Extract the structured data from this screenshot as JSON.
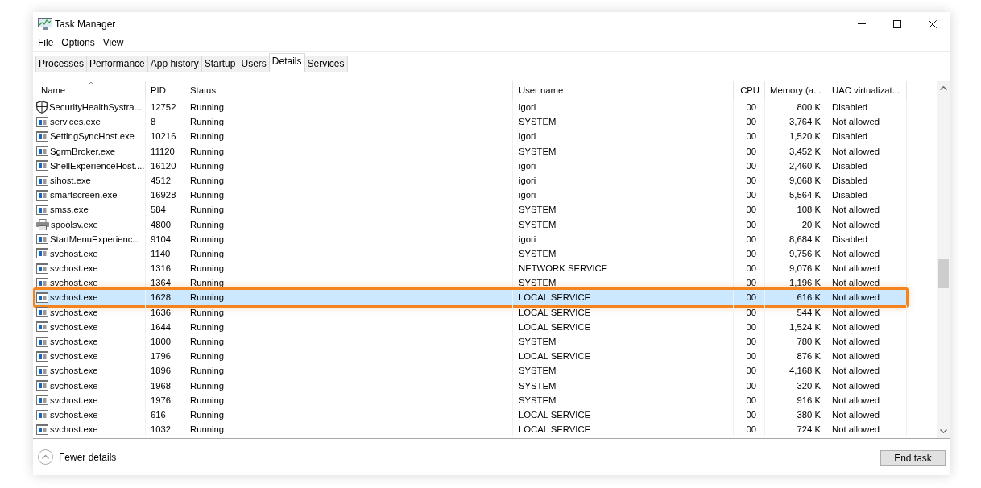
{
  "window": {
    "title": "Task Manager"
  },
  "menu": [
    "File",
    "Options",
    "View"
  ],
  "tabs": [
    {
      "label": "Processes",
      "selected": false
    },
    {
      "label": "Performance",
      "selected": false
    },
    {
      "label": "App history",
      "selected": false
    },
    {
      "label": "Startup",
      "selected": false
    },
    {
      "label": "Users",
      "selected": false
    },
    {
      "label": "Details",
      "selected": true
    },
    {
      "label": "Services",
      "selected": false
    }
  ],
  "table": {
    "columns": [
      {
        "label": "Name",
        "sorted": true
      },
      {
        "label": "PID",
        "sorted": false
      },
      {
        "label": "Status",
        "sorted": false
      },
      {
        "label": "User name",
        "sorted": false
      },
      {
        "label": "CPU",
        "sorted": false
      },
      {
        "label": "Memory (a...",
        "sorted": false
      },
      {
        "label": "UAC virtualizat...",
        "sorted": false
      }
    ],
    "rows": [
      {
        "kind": "shield",
        "name": "SecurityHealthSystra...",
        "pid": "12752",
        "status": "Running",
        "user": "igori",
        "cpu": "00",
        "memory": "800 K",
        "uac": "Disabled",
        "selected": false,
        "highlighted": false
      },
      {
        "kind": "app",
        "name": "services.exe",
        "pid": "8",
        "status": "Running",
        "user": "SYSTEM",
        "cpu": "00",
        "memory": "3,764 K",
        "uac": "Not allowed",
        "selected": false,
        "highlighted": false
      },
      {
        "kind": "app",
        "name": "SettingSyncHost.exe",
        "pid": "10216",
        "status": "Running",
        "user": "igori",
        "cpu": "00",
        "memory": "1,520 K",
        "uac": "Disabled",
        "selected": false,
        "highlighted": false
      },
      {
        "kind": "app",
        "name": "SgrmBroker.exe",
        "pid": "11120",
        "status": "Running",
        "user": "SYSTEM",
        "cpu": "00",
        "memory": "3,452 K",
        "uac": "Not allowed",
        "selected": false,
        "highlighted": false
      },
      {
        "kind": "app",
        "name": "ShellExperienceHost....",
        "pid": "16120",
        "status": "Running",
        "user": "igori",
        "cpu": "00",
        "memory": "2,460 K",
        "uac": "Disabled",
        "selected": false,
        "highlighted": false
      },
      {
        "kind": "app",
        "name": "sihost.exe",
        "pid": "4512",
        "status": "Running",
        "user": "igori",
        "cpu": "00",
        "memory": "9,068 K",
        "uac": "Disabled",
        "selected": false,
        "highlighted": false
      },
      {
        "kind": "app",
        "name": "smartscreen.exe",
        "pid": "16928",
        "status": "Running",
        "user": "igori",
        "cpu": "00",
        "memory": "5,564 K",
        "uac": "Disabled",
        "selected": false,
        "highlighted": false
      },
      {
        "kind": "app",
        "name": "smss.exe",
        "pid": "584",
        "status": "Running",
        "user": "SYSTEM",
        "cpu": "00",
        "memory": "108 K",
        "uac": "Not allowed",
        "selected": false,
        "highlighted": false
      },
      {
        "kind": "printer",
        "name": "spoolsv.exe",
        "pid": "4800",
        "status": "Running",
        "user": "SYSTEM",
        "cpu": "00",
        "memory": "20 K",
        "uac": "Not allowed",
        "selected": false,
        "highlighted": false
      },
      {
        "kind": "app",
        "name": "StartMenuExperienc...",
        "pid": "9104",
        "status": "Running",
        "user": "igori",
        "cpu": "00",
        "memory": "8,684 K",
        "uac": "Disabled",
        "selected": false,
        "highlighted": false
      },
      {
        "kind": "app",
        "name": "svchost.exe",
        "pid": "1140",
        "status": "Running",
        "user": "SYSTEM",
        "cpu": "00",
        "memory": "9,756 K",
        "uac": "Not allowed",
        "selected": false,
        "highlighted": false
      },
      {
        "kind": "app",
        "name": "svchost.exe",
        "pid": "1316",
        "status": "Running",
        "user": "NETWORK SERVICE",
        "cpu": "00",
        "memory": "9,076 K",
        "uac": "Not allowed",
        "selected": false,
        "highlighted": false
      },
      {
        "kind": "app",
        "name": "svchost.exe",
        "pid": "1364",
        "status": "Running",
        "user": "SYSTEM",
        "cpu": "00",
        "memory": "1,196 K",
        "uac": "Not allowed",
        "selected": false,
        "highlighted": false
      },
      {
        "kind": "app",
        "name": "svchost.exe",
        "pid": "1628",
        "status": "Running",
        "user": "LOCAL SERVICE",
        "cpu": "00",
        "memory": "616 K",
        "uac": "Not allowed",
        "selected": true,
        "highlighted": true
      },
      {
        "kind": "app",
        "name": "svchost.exe",
        "pid": "1636",
        "status": "Running",
        "user": "LOCAL SERVICE",
        "cpu": "00",
        "memory": "544 K",
        "uac": "Not allowed",
        "selected": false,
        "highlighted": false
      },
      {
        "kind": "app",
        "name": "svchost.exe",
        "pid": "1644",
        "status": "Running",
        "user": "LOCAL SERVICE",
        "cpu": "00",
        "memory": "1,524 K",
        "uac": "Not allowed",
        "selected": false,
        "highlighted": false
      },
      {
        "kind": "app",
        "name": "svchost.exe",
        "pid": "1800",
        "status": "Running",
        "user": "SYSTEM",
        "cpu": "00",
        "memory": "780 K",
        "uac": "Not allowed",
        "selected": false,
        "highlighted": false
      },
      {
        "kind": "app",
        "name": "svchost.exe",
        "pid": "1796",
        "status": "Running",
        "user": "LOCAL SERVICE",
        "cpu": "00",
        "memory": "876 K",
        "uac": "Not allowed",
        "selected": false,
        "highlighted": false
      },
      {
        "kind": "app",
        "name": "svchost.exe",
        "pid": "1896",
        "status": "Running",
        "user": "SYSTEM",
        "cpu": "00",
        "memory": "4,168 K",
        "uac": "Not allowed",
        "selected": false,
        "highlighted": false
      },
      {
        "kind": "app",
        "name": "svchost.exe",
        "pid": "1968",
        "status": "Running",
        "user": "SYSTEM",
        "cpu": "00",
        "memory": "320 K",
        "uac": "Not allowed",
        "selected": false,
        "highlighted": false
      },
      {
        "kind": "app",
        "name": "svchost.exe",
        "pid": "1976",
        "status": "Running",
        "user": "SYSTEM",
        "cpu": "00",
        "memory": "916 K",
        "uac": "Not allowed",
        "selected": false,
        "highlighted": false
      },
      {
        "kind": "app",
        "name": "svchost.exe",
        "pid": "616",
        "status": "Running",
        "user": "LOCAL SERVICE",
        "cpu": "00",
        "memory": "380 K",
        "uac": "Not allowed",
        "selected": false,
        "highlighted": false
      },
      {
        "kind": "app",
        "name": "svchost.exe",
        "pid": "1032",
        "status": "Running",
        "user": "LOCAL SERVICE",
        "cpu": "00",
        "memory": "724 K",
        "uac": "Not allowed",
        "selected": false,
        "highlighted": false
      }
    ]
  },
  "footer": {
    "toggle": "Fewer details",
    "button": "End task"
  }
}
